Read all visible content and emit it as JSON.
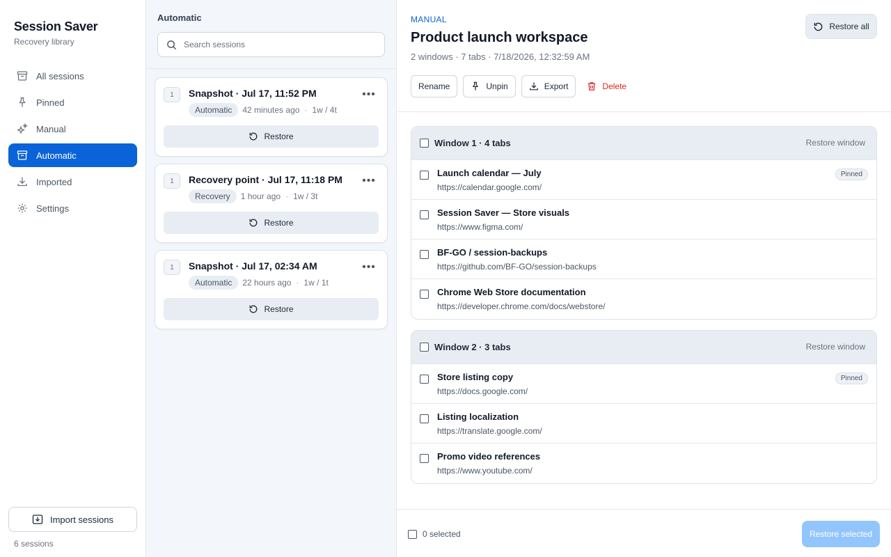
{
  "sidebar": {
    "app_title": "Session Saver",
    "app_subtitle": "Recovery library",
    "items": [
      {
        "label": "All sessions",
        "icon": "archive-icon"
      },
      {
        "label": "Pinned",
        "icon": "pin-icon"
      },
      {
        "label": "Manual",
        "icon": "sparkles-icon"
      },
      {
        "label": "Automatic",
        "icon": "archive-icon",
        "active": true
      },
      {
        "label": "Imported",
        "icon": "download-icon"
      },
      {
        "label": "Settings",
        "icon": "gear-icon"
      }
    ],
    "import_label": "Import sessions",
    "session_count": "6 sessions"
  },
  "list": {
    "title": "Automatic",
    "search_placeholder": "Search sessions",
    "cards": [
      {
        "count": "1",
        "title": "Snapshot · Jul 17, 11:52 PM",
        "tag": "Automatic",
        "age": "42 minutes ago",
        "size": "1w / 4t",
        "restore_label": "Restore"
      },
      {
        "count": "1",
        "title": "Recovery point · Jul 17, 11:18 PM",
        "tag": "Recovery",
        "age": "1 hour ago",
        "size": "1w / 3t",
        "restore_label": "Restore"
      },
      {
        "count": "1",
        "title": "Snapshot · Jul 17, 02:34 AM",
        "tag": "Automatic",
        "age": "22 hours ago",
        "size": "1w / 1t",
        "restore_label": "Restore"
      }
    ]
  },
  "detail": {
    "kicker": "MANUAL",
    "title": "Product launch workspace",
    "meta": "2 windows · 7 tabs · 7/18/2026, 12:32:59 AM",
    "restore_all_label": "Restore all",
    "actions": {
      "rename": "Rename",
      "unpin": "Unpin",
      "export": "Export",
      "delete": "Delete"
    },
    "restore_window_label": "Restore window",
    "pinned_label": "Pinned",
    "windows": [
      {
        "title": "Window 1 · 4 tabs",
        "tabs": [
          {
            "title": "Launch calendar — July",
            "url": "https://calendar.google.com/",
            "pinned": true
          },
          {
            "title": "Session Saver — Store visuals",
            "url": "https://www.figma.com/",
            "pinned": false
          },
          {
            "title": "BF-GO / session-backups",
            "url": "https://github.com/BF-GO/session-backups",
            "pinned": false
          },
          {
            "title": "Chrome Web Store documentation",
            "url": "https://developer.chrome.com/docs/webstore/",
            "pinned": false
          }
        ]
      },
      {
        "title": "Window 2 · 3 tabs",
        "tabs": [
          {
            "title": "Store listing copy",
            "url": "https://docs.google.com/",
            "pinned": true
          },
          {
            "title": "Listing localization",
            "url": "https://translate.google.com/",
            "pinned": false
          },
          {
            "title": "Promo video references",
            "url": "https://www.youtube.com/",
            "pinned": false
          }
        ]
      }
    ],
    "selected_count": "0 selected",
    "restore_selected_label": "Restore selected"
  },
  "colors": {
    "accent": "#0a63d8",
    "danger": "#dc2626",
    "disabled_primary": "#93c5fd"
  }
}
